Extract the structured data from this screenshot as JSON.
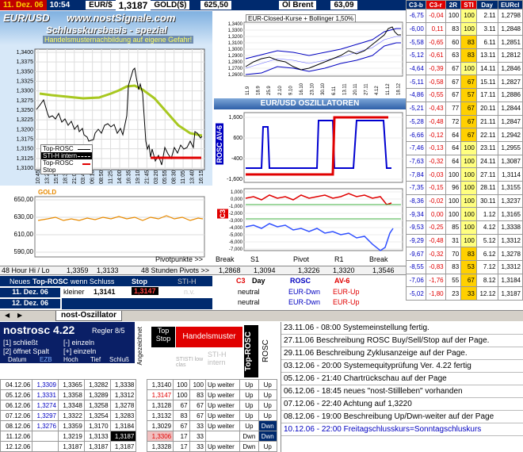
{
  "header": {
    "date": "11. Dez. 06",
    "time": "10:54",
    "eur_label": "EUR/$",
    "eur_value": "1,3187",
    "gold_label": "GOLD($)",
    "gold_value": "625,50",
    "oil_label": "Öl Brent",
    "oil_value": "63,09"
  },
  "main_chart": {
    "pair": "EUR/USD",
    "site": "www.nostSignale.com",
    "subtitle": "Schlusskursbasis - spezial",
    "warning": "Handelsmusternachbildung auf eigene Gefahr!",
    "yticks": [
      "1,3400",
      "1,3375",
      "1,3350",
      "1,3325",
      "1,3300",
      "1,3275",
      "1,3250",
      "1,3225",
      "1,3200",
      "1,3175",
      "1,3150",
      "1,3125",
      "1,3100"
    ],
    "xticks": [
      "10:45",
      "13:20",
      "15:55",
      "18:30",
      "21:05",
      "03:40",
      "06:15",
      "08:50",
      "11:25",
      "14:00",
      "16:35",
      "19:10",
      "21:45",
      "03:20",
      "05:55",
      "08:30",
      "11:05",
      "13:40",
      "16:15"
    ],
    "legend": [
      {
        "label": "Top-ROSC",
        "color": "#000000"
      },
      {
        "label": "STI-H intern",
        "color": "#ffffff"
      },
      {
        "label": "Top-ROSC Stop",
        "color": "#e00000"
      }
    ]
  },
  "gold_chart": {
    "title": "GOLD",
    "yticks": [
      "650,00",
      "630,00",
      "610,00",
      "590,00"
    ],
    "pivot_label": "Pivotpunkte >>"
  },
  "bollinger": {
    "title": "EUR-Closed-Kurse + Bollinger 1,50%",
    "yticks": [
      "1,3400",
      "1,3300",
      "1,3200",
      "1,3100",
      "1,3000",
      "1,2900",
      "1,2800",
      "1,2700",
      "1,2600"
    ],
    "xticks": [
      "11.9",
      "18.9",
      "25.9",
      "2.10",
      "9.10",
      "16.10",
      "23.10",
      "30.10",
      "6.11",
      "13.11",
      "20.11",
      "27.11",
      "4.12",
      "11.12",
      "18.12"
    ]
  },
  "oscillator": {
    "title": "EUR/USD  OSZILLATOREN",
    "rosc_label": "ROSC AV-6",
    "rosc_yticks": [
      "1,600",
      "600",
      "-400",
      "-1,600"
    ],
    "c3_label": "C3",
    "c3_yticks": [
      "1,000",
      "0,000",
      "-1,000",
      "-2,000",
      "-3,000",
      "-4,000",
      "-5,000",
      "-6,000",
      "-7,000"
    ]
  },
  "hilo": {
    "label": "48 Hour Hi / Lo",
    "hi": "1,3359",
    "lo": "1,3133",
    "pivots_label": "48 Stunden Pivots >>"
  },
  "pivots": {
    "headers": [
      "Break",
      "S1",
      "Pivot",
      "R1",
      "Break"
    ],
    "values": [
      "1,2868",
      "1,3094",
      "1,3226",
      "1,3320",
      "1,3546"
    ]
  },
  "signal": {
    "head": "Neues",
    "title": "Top-ROSC",
    "tail": "wenn Schluss",
    "stop": "Stop",
    "sti": "STI-H",
    "kleiner": "kleiner",
    "val1": "1,3141",
    "stopval": "1,3147",
    "na": "n.v.",
    "date1": "11. Dez. 06",
    "date2": "12. Dez. 06"
  },
  "status": {
    "c3": "C3",
    "day": "Day",
    "rosc": "ROSC",
    "av6": "AV-6",
    "rows": [
      [
        "neutral",
        "EUR-Dwn",
        "EUR-Up"
      ],
      [
        "neutral",
        "EUR-Dwn",
        "EUR-Up"
      ]
    ]
  },
  "sidebar": {
    "headers": [
      "C3-b",
      "C3-r",
      "2R",
      "STI",
      "Day",
      "EURcl"
    ],
    "rows": [
      [
        "-6,75",
        "-0,04",
        "100",
        "100",
        "2.11",
        "1,2798"
      ],
      [
        "-6,00",
        "0,11",
        "83",
        "100",
        "3.11",
        "1,2848"
      ],
      [
        "-5,58",
        "-0,65",
        "60",
        "83",
        "6.11",
        "1,2851"
      ],
      [
        "-5,12",
        "-0,61",
        "63",
        "83",
        "13.11",
        "1,2812"
      ],
      [
        "-4,64",
        "-0,39",
        "67",
        "100",
        "14.11",
        "1,2846"
      ],
      [
        "-5,11",
        "-0,58",
        "67",
        "67",
        "15.11",
        "1,2827"
      ],
      [
        "-4,86",
        "-0,55",
        "67",
        "57",
        "17.11",
        "1,2886"
      ],
      [
        "-5,21",
        "-0,43",
        "77",
        "67",
        "20.11",
        "1,2844"
      ],
      [
        "-5,28",
        "-0,48",
        "72",
        "67",
        "21.11",
        "1,2847"
      ],
      [
        "-6,66",
        "-0,12",
        "64",
        "67",
        "22.11",
        "1,2942"
      ],
      [
        "-7,46",
        "-0,13",
        "64",
        "100",
        "23.11",
        "1,2955"
      ],
      [
        "-7,63",
        "-0,32",
        "64",
        "100",
        "24.11",
        "1,3087"
      ],
      [
        "-7,84",
        "-0,03",
        "100",
        "100",
        "27.11",
        "1,3114"
      ],
      [
        "-7,35",
        "-0,15",
        "96",
        "100",
        "28.11",
        "1,3155"
      ],
      [
        "-8,36",
        "-0,02",
        "100",
        "100",
        "30.11",
        "1,3237"
      ],
      [
        "-9,34",
        "0,00",
        "100",
        "100",
        "1.12",
        "1,3165"
      ],
      [
        "-9,53",
        "-0,25",
        "85",
        "100",
        "4.12",
        "1,3338"
      ],
      [
        "-9,29",
        "-0,48",
        "31",
        "100",
        "5.12",
        "1,3312"
      ],
      [
        "-9,67",
        "-0,32",
        "70",
        "83",
        "6.12",
        "1,3278"
      ],
      [
        "-8,55",
        "-0,83",
        "83",
        "53",
        "7.12",
        "1,3312"
      ],
      [
        "-7,06",
        "-1,76",
        "55",
        "67",
        "8.12",
        "1,3184"
      ],
      [
        "-5,02",
        "-1,80",
        "23",
        "33",
        "12.12",
        "1,3187"
      ]
    ]
  },
  "tab": {
    "label": "nost-Oszillator"
  },
  "bottom": {
    "title": "nostrosc 4.22",
    "regler": "Regler 8/5",
    "k1": "[1] schließt",
    "k2": "[2] öffnet Spalt",
    "k3": "[-] einzeln",
    "k4": "[+] einzeln",
    "headers": [
      "Datum",
      "EZB",
      "Hoch",
      "Tief",
      "Schluß"
    ],
    "vertical": "Angezeichnet",
    "top_stop": "Top Stop",
    "handelsmuster": "Handelsmuster",
    "sti": "STI-H intern",
    "sti_small": "STISTI low clas",
    "top_rosc": "Top-ROSC",
    "rosc": "ROSC",
    "rows": [
      [
        "04.12.06",
        "1,3309",
        "1,3365",
        "1,3282",
        "1,3338",
        "1,3140",
        "100",
        "100",
        "Up weiter",
        "Up",
        "Up"
      ],
      [
        "05.12.06",
        "1,3331",
        "1,3358",
        "1,3289",
        "1,3312",
        "1,3147",
        "100",
        "83",
        "Up weiter",
        "Up",
        "Up"
      ],
      [
        "06.12.06",
        "1,3274",
        "1,3348",
        "1,3258",
        "1,3278",
        "1,3128",
        "67",
        "67",
        "Up weiter",
        "Up",
        "Up"
      ],
      [
        "07.12.06",
        "1,3297",
        "1,3322",
        "1,3254",
        "1,3283",
        "1,3132",
        "83",
        "67",
        "Up weiter",
        "Up",
        "Up"
      ],
      [
        "08.12.06",
        "1,3276",
        "1,3359",
        "1,3170",
        "1,3184",
        "1,3029",
        "67",
        "33",
        "Up weiter",
        "Up",
        "Dwn"
      ],
      [
        "11.12.06",
        "",
        "1,3219",
        "1,3133",
        "1,3187",
        "1,3306",
        "17",
        "33",
        "",
        "Dwn",
        "Dwn"
      ],
      [
        "12.12.06",
        "",
        "1,3187",
        "1,3187",
        "1,3187",
        "1,3328",
        "17",
        "33",
        "Up weiter",
        "Dwn",
        "Up"
      ]
    ]
  },
  "news": [
    "23.11.06 - 08:00 Systemeinstellung fertig.",
    "27.11.06 Beschreibung ROSC Buy/Sell/Stop auf der Page.",
    "29.11.06 Beschreibung Zyklusanzeige auf der Page.",
    "03.12.06 - 20:00 Systemequityprüfung Ver. 4.22 fertig",
    "05.12.06 - 21:40 Chartrückschau auf der Page",
    "06.12.06 - 18:45 neues \"nost-Stillleben\" vorhanden",
    "07.12.06 - 22:40 Achtung auf 1,3220",
    "08.12.06 - 19:00 Beschreibung Up/Dwn-weiter auf der Page",
    "10.12.06 - 22:00 Freitagschlusskurs=Sonntagschluskurs"
  ],
  "colors": {
    "navy": "#002a6e",
    "red": "#e00000",
    "yellow": "#ffff80",
    "blue": "#0000ff",
    "green": "#a8c820"
  }
}
